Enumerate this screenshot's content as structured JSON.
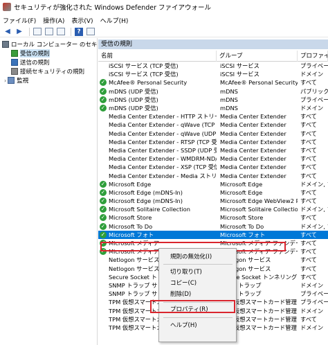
{
  "window": {
    "title": "セキュリティが強化された Windows Defender ファイアウォール"
  },
  "menubar": [
    "ファイル(F)",
    "操作(A)",
    "表示(V)",
    "ヘルプ(H)"
  ],
  "tree": {
    "root": "ローカル コンピューター のセキュリティが",
    "items": [
      "受信の規則",
      "送信の規則",
      "接続セキュリティの規則",
      "監視"
    ]
  },
  "panel": {
    "title": "受信の規則",
    "columns": {
      "name": "名前",
      "group": "グループ",
      "profile": "プロファイル"
    }
  },
  "rows": [
    {
      "name": "iSCSI サービス (TCP 受信)",
      "group": "iSCSI サービス",
      "profile": "プライベー",
      "enabled": false
    },
    {
      "name": "iSCSI サービス (TCP 受信)",
      "group": "iSCSI サービス",
      "profile": "ドメイン",
      "enabled": false
    },
    {
      "name": "McAfee® Personal Security",
      "group": "McAfee® Personal Security",
      "profile": "すべて",
      "enabled": true
    },
    {
      "name": "mDNS (UDP 受信)",
      "group": "mDNS",
      "profile": "パブリック",
      "enabled": true
    },
    {
      "name": "mDNS (UDP 受信)",
      "group": "mDNS",
      "profile": "プライベー",
      "enabled": true
    },
    {
      "name": "mDNS (UDP 受信)",
      "group": "mDNS",
      "profile": "ドメイン",
      "enabled": true
    },
    {
      "name": "Media Center Extender - HTTP ストリーミ...",
      "group": "Media Center Extender",
      "profile": "すべて",
      "enabled": false
    },
    {
      "name": "Media Center Extender - qWave (TCP 受信)",
      "group": "Media Center Extender",
      "profile": "すべて",
      "enabled": false
    },
    {
      "name": "Media Center Extender - qWave (UDP 受信)",
      "group": "Media Center Extender",
      "profile": "すべて",
      "enabled": false
    },
    {
      "name": "Media Center Extender - RTSP (TCP 受信)",
      "group": "Media Center Extender",
      "profile": "すべて",
      "enabled": false
    },
    {
      "name": "Media Center Extender - SSDP (UDP 受信)",
      "group": "Media Center Extender",
      "profile": "すべて",
      "enabled": false
    },
    {
      "name": "Media Center Extender - WMDRM-ND/R...",
      "group": "Media Center Extender",
      "profile": "すべて",
      "enabled": false
    },
    {
      "name": "Media Center Extender - XSP (TCP 受信)",
      "group": "Media Center Extender",
      "profile": "すべて",
      "enabled": false
    },
    {
      "name": "Media Center Extender - Media ストリーミ...",
      "group": "Media Center Extender",
      "profile": "すべて",
      "enabled": false
    },
    {
      "name": "Microsoft Edge",
      "group": "Microsoft Edge",
      "profile": "ドメイン, プラ",
      "enabled": true
    },
    {
      "name": "Microsoft Edge (mDNS-In)",
      "group": "Microsoft Edge",
      "profile": "すべて",
      "enabled": true
    },
    {
      "name": "Microsoft Edge (mDNS-In)",
      "group": "Microsoft Edge WebView2 R...",
      "profile": "すべて",
      "enabled": true
    },
    {
      "name": "Microsoft Solitaire Collection",
      "group": "Microsoft Solitaire Collection",
      "profile": "ドメイン, プラ",
      "enabled": true
    },
    {
      "name": "Microsoft Store",
      "group": "Microsoft Store",
      "profile": "すべて",
      "enabled": true
    },
    {
      "name": "Microsoft To Do",
      "group": "Microsoft To Do",
      "profile": "ドメイン, プラ",
      "enabled": true
    },
    {
      "name": "Microsoft フォト",
      "group": "Microsoft フォト",
      "profile": "すべて",
      "enabled": true,
      "selected": true
    },
    {
      "name": "Microsoft メディア",
      "group": "Microsoft メディア ファンデーショ...",
      "profile": "すべて",
      "enabled": true
    },
    {
      "name": "Microsoft メディア",
      "group": "Microsoft メディア ファンデーショ...",
      "profile": "すべて",
      "enabled": true
    },
    {
      "name": "Netlogon サービス",
      "group": "Netlogon サービス",
      "profile": "すべて",
      "enabled": false
    },
    {
      "name": "Netlogon サービス",
      "group": "Netlogon サービス",
      "profile": "すべて",
      "enabled": false
    },
    {
      "name": "Secure Socket ト",
      "group": "Secure Socket トンネリング プロ...",
      "profile": "すべて",
      "enabled": false
    },
    {
      "name": "SNMP トラップ サ",
      "group": "SNMP トラップ",
      "profile": "ドメイン",
      "enabled": false
    },
    {
      "name": "SNMP トラップ サ",
      "group": "SNMP トラップ",
      "profile": "プライベー",
      "enabled": false
    },
    {
      "name": "TPM 仮想スマートカ",
      "group": "TPM 仮想スマートカード管理",
      "profile": "プライベー",
      "enabled": false
    },
    {
      "name": "TPM 仮想スマートカード管理 (TCP 受信)",
      "group": "TPM 仮想スマートカード管理",
      "profile": "ドメイン",
      "enabled": false
    },
    {
      "name": "TPM 仮想スマートカード管理 (DCOM 受信)",
      "group": "TPM 仮想スマートカード管理",
      "profile": "すべて",
      "enabled": false
    },
    {
      "name": "TPM 仮想スマートカード管理 (DCOM 受信)",
      "group": "TPM 仮想スマートカード管理",
      "profile": "ドメイン",
      "enabled": false
    }
  ],
  "context_menu": {
    "disable_rule": "規則の無効化(I)",
    "cut": "切り取り(T)",
    "copy": "コピー(C)",
    "delete": "削除(D)",
    "properties": "プロパティ(R)",
    "help": "ヘルプ(H)"
  },
  "colors": {
    "selection": "#0078d7",
    "highlight_border": "#d9262e",
    "enabled_check": "#2e9e3a"
  }
}
